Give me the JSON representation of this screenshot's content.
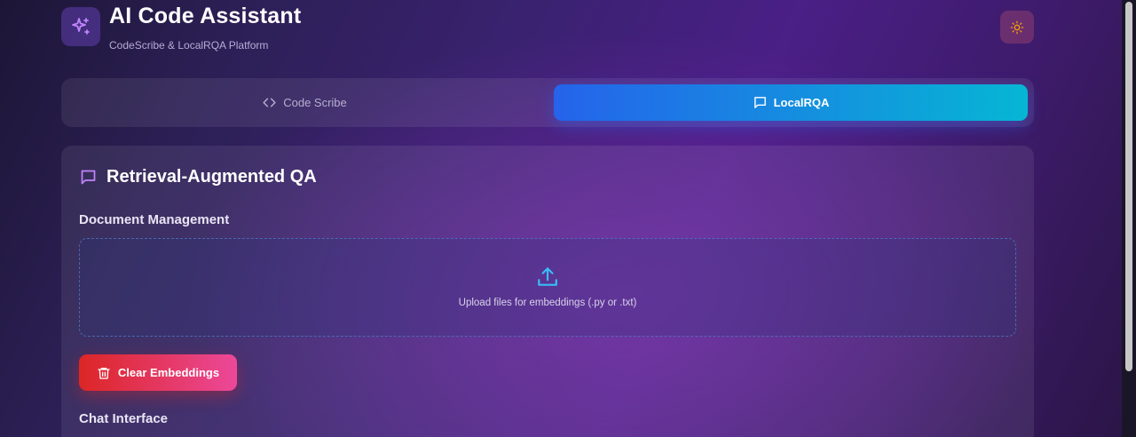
{
  "header": {
    "title": "AI Code Assistant",
    "subtitle": "CodeScribe & LocalRQA Platform",
    "logo_icon": "sparkles-icon",
    "theme_icon": "sun-icon"
  },
  "tabs": [
    {
      "label": "Code Scribe",
      "icon": "code-icon",
      "active": false
    },
    {
      "label": "LocalRQA",
      "icon": "message-square-icon",
      "active": true
    }
  ],
  "card": {
    "title": "Retrieval-Augmented QA",
    "title_icon": "message-square-icon",
    "document_section_label": "Document Management",
    "upload_text": "Upload files for embeddings (.py or .txt)",
    "upload_icon": "upload-icon",
    "clear_button_label": "Clear Embeddings",
    "clear_icon": "trash-icon",
    "chat_section_label": "Chat Interface"
  },
  "colors": {
    "active_tab_start": "#2563eb",
    "active_tab_end": "#06b6d4",
    "clear_button_start": "#dc2626",
    "clear_button_end": "#ec4899",
    "upload_icon": "#38bdf8",
    "accent_purple": "#c084fc",
    "sun_icon": "#f59e0b"
  }
}
